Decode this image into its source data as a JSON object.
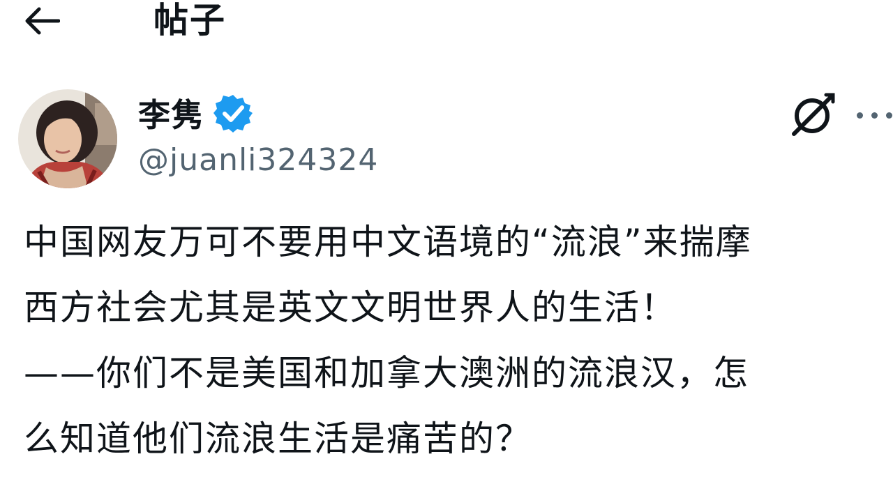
{
  "header": {
    "back_icon": "arrow-left-icon",
    "title": "帖子"
  },
  "author": {
    "display_name": "李隽",
    "verified_icon": "verified-badge-icon",
    "verified_color": "#1d9bf0",
    "handle": "@juanli324324",
    "avatar_icon": "avatar-photo"
  },
  "actions": {
    "grok_icon": "grok-icon",
    "more_icon": "more-horizontal-icon"
  },
  "post": {
    "lines": [
      "中国网友万可不要用中文语境的“流浪”来揣摩",
      "西方社会尤其是英文文明世界人的生活！",
      "——你们不是美国和加拿大澳洲的流浪汉，怎",
      "么知道他们流浪生活是痛苦的？"
    ]
  },
  "colors": {
    "text": "#0f1419",
    "secondary": "#536471",
    "background": "#ffffff"
  }
}
